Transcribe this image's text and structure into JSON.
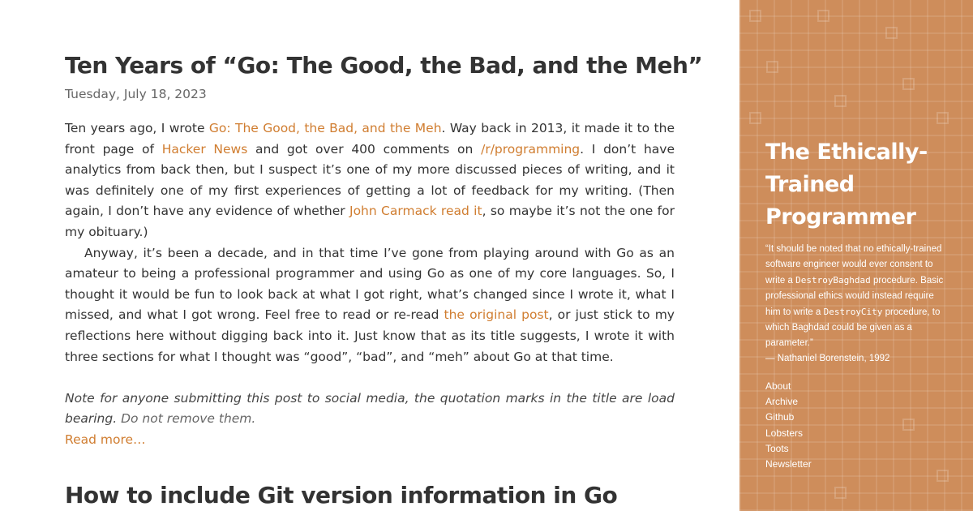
{
  "posts": [
    {
      "title": "Ten Years of “Go: The Good, the Bad, and the Meh”",
      "date": "Tuesday, July 18, 2023",
      "p1": [
        "Ten years ago, I wrote ",
        "Go: The Good, the Bad, and the Meh",
        ". Way back in 2013, it made it to the front page of ",
        "Hacker News",
        " and got over 400 comments on ",
        "/r/programming",
        ". I don’t have analytics from back then, but I suspect it’s one of my more discussed pieces of writing, and it was definitely one of my first experiences of getting a lot of feedback for my writing. (Then again, I don’t have any evidence of whether ",
        "John Carmack read it",
        ", so maybe it’s not the one for my obituary.)"
      ],
      "p2": [
        "Anyway, it’s been a decade, and in that time I’ve gone from playing around with Go as an amateur to being a professional programmer and using Go as one of my core languages. So, I thought it would be fun to look back at what I got right, what’s changed since I wrote it, what I missed, and what I got wrong. Feel free to read or re-read ",
        "the original post",
        ", or just stick to my reflections here without digging back into it. Just know that as its title suggests, I wrote it with three sections for what I thought was “good”, “bad”, and “meh” about Go at that time."
      ],
      "note": "Note for anyone submitting this post to social media, the quotation marks in the title are load bearing.",
      "note_emphasis": " Do not remove them.",
      "read_more": "Read more…"
    },
    {
      "title": "How to include Git version information in Go"
    }
  ],
  "sidebar": {
    "title": "The Ethically-Trained Programmer",
    "quote": [
      "“It should be noted that no ethically-trained software engineer would ever consent to write a ",
      "DestroyBaghdad",
      " procedure. Basic professional ethics would instead require him to write a ",
      "DestroyCity",
      " procedure, to which Baghdad could be given as a parameter.”"
    ],
    "attribution": "— Nathaniel Borenstein, 1992",
    "nav": [
      "About",
      "Archive",
      "Github",
      "Lobsters",
      "Toots",
      "Newsletter"
    ],
    "background_color": "#ce8d5b"
  },
  "colors": {
    "link": "#d07d30",
    "text": "#333333",
    "muted": "#666666"
  }
}
